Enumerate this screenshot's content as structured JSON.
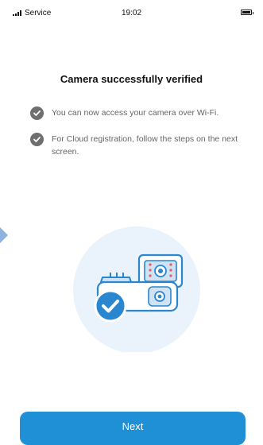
{
  "status_bar": {
    "carrier": "Service",
    "time": "19:02"
  },
  "main": {
    "title": "Camera successfully verified",
    "checklist": [
      {
        "text": "You can now access your camera over Wi-Fi.",
        "icon": "check-circle-icon"
      },
      {
        "text": "For Cloud registration, follow the steps on the next screen.",
        "icon": "check-circle-icon"
      }
    ],
    "illustration": "camera-verified-illustration"
  },
  "footer": {
    "next_label": "Next"
  },
  "colors": {
    "accent": "#1f8fd6",
    "check_gray": "#6f6f6f",
    "illustration_blue": "#2b86d0",
    "illustration_bg": "#eaf3fb"
  }
}
